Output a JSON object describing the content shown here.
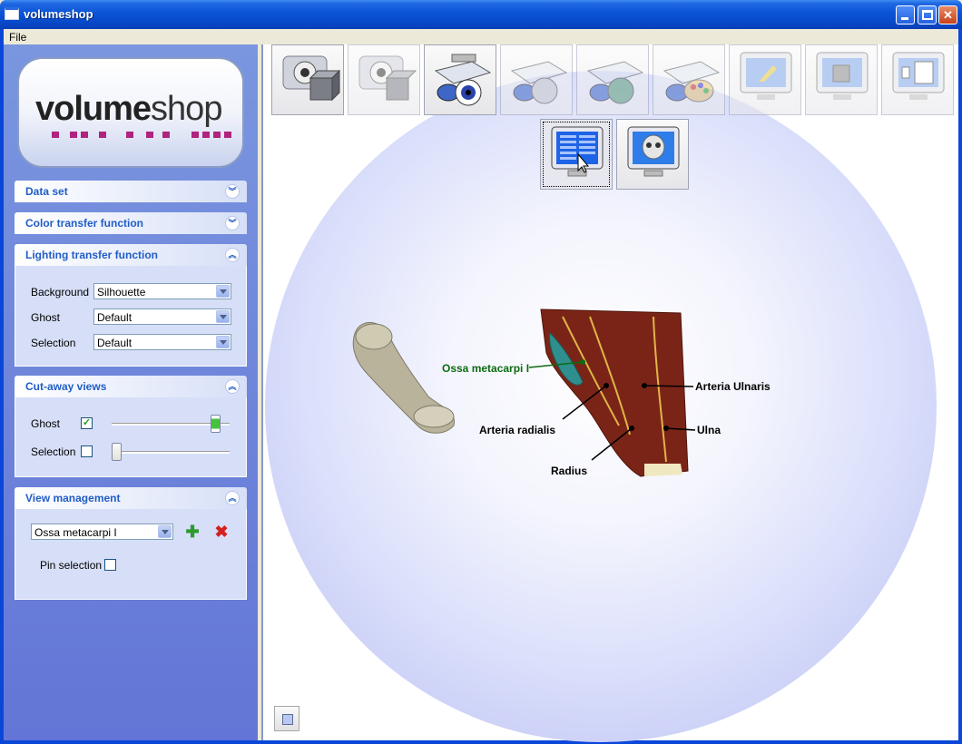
{
  "window": {
    "title": "volumeshop"
  },
  "menu": {
    "file": "File"
  },
  "logo": {
    "word1": "volume",
    "word2": "shop"
  },
  "panels": {
    "data_set": {
      "title": "Data set"
    },
    "color_tf": {
      "title": "Color transfer function"
    },
    "lighting_tf": {
      "title": "Lighting transfer function",
      "rows": [
        {
          "label": "Background",
          "value": "Silhouette"
        },
        {
          "label": "Ghost",
          "value": "Default"
        },
        {
          "label": "Selection",
          "value": "Default"
        }
      ]
    },
    "cutaway": {
      "title": "Cut-away views",
      "ghost_label": "Ghost",
      "ghost_checked": true,
      "ghost_slider_value": 0.92,
      "selection_label": "Selection",
      "selection_checked": false,
      "selection_slider_value": 0.0
    },
    "view_mgmt": {
      "title": "View management",
      "view_value": "Ossa metacarpi I",
      "add_icon": "green-plus-icon",
      "delete_icon": "red-x-icon",
      "pin_label": "Pin selection",
      "pin_checked": false
    }
  },
  "viewport": {
    "annotations": {
      "ossa": "Ossa metacarpi I",
      "arteria_ulnaris": "Arteria Ulnaris",
      "arteria_radialis": "Arteria radialis",
      "ulna": "Ulna",
      "radius": "Radius"
    },
    "toolbar_icons": [
      "camera-cube-icon",
      "camera-cube-dim-icon",
      "scanner-eye-icon",
      "scanner-skull-icon",
      "scanner-lungs-icon",
      "scanner-palette-icon",
      "monitor-arrow-icon",
      "monitor-cube-icon",
      "monitor-panels-icon",
      "monitor-grid-icon",
      "monitor-skull-icon"
    ]
  }
}
